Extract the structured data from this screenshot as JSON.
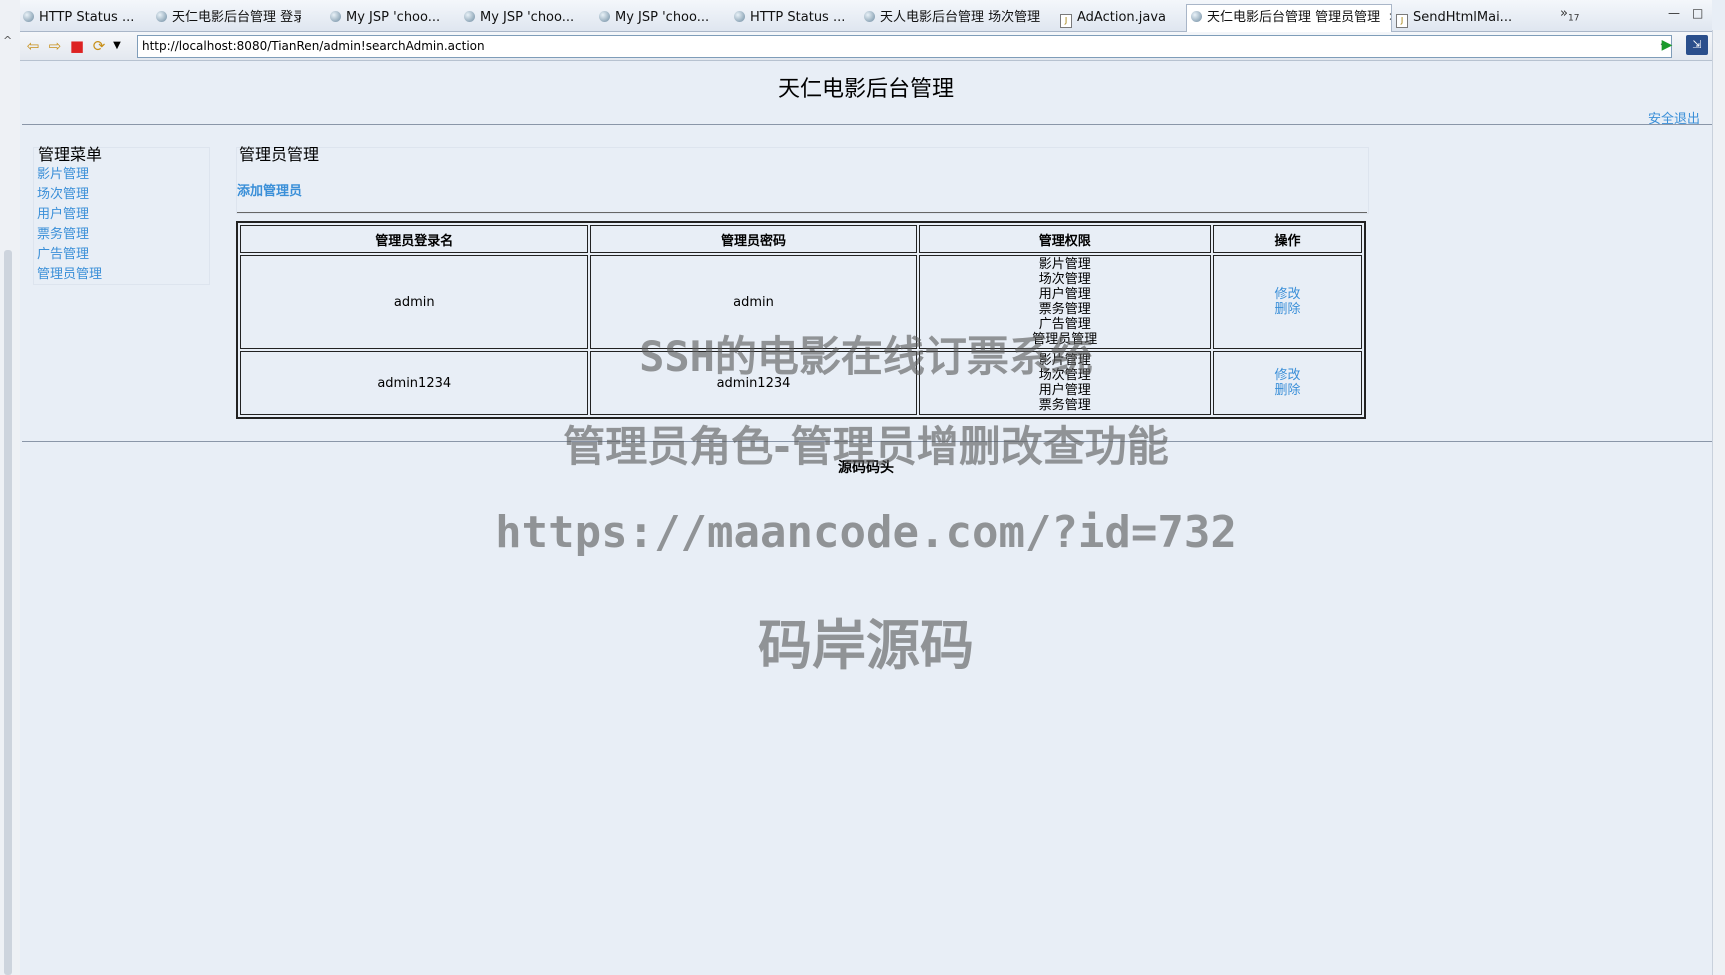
{
  "browser": {
    "tabs": [
      {
        "label": "HTTP Status ...",
        "icon": "globe-icon"
      },
      {
        "label": "天仁电影后台管理 登录",
        "icon": "globe-icon"
      },
      {
        "label": "My JSP 'choo...",
        "icon": "globe-icon"
      },
      {
        "label": "My JSP 'choo...",
        "icon": "globe-icon"
      },
      {
        "label": "My JSP 'choo...",
        "icon": "globe-icon"
      },
      {
        "label": "HTTP Status ...",
        "icon": "globe-icon"
      },
      {
        "label": "天人电影后台管理 场次管理",
        "icon": "globe-icon"
      },
      {
        "label": "AdAction.java",
        "icon": "java-file-icon"
      },
      {
        "label": "天仁电影后台管理 管理员管理",
        "icon": "globe-icon",
        "active": true
      },
      {
        "label": "SendHtmlMai...",
        "icon": "java-file-icon"
      }
    ],
    "overflow": {
      "glyph": "»",
      "count": "17"
    },
    "url": "http://localhost:8080/TianRen/admin!searchAdmin.action"
  },
  "page": {
    "title": "天仁电影后台管理",
    "logout": "安全退出",
    "menu": {
      "title": "管理菜单",
      "items": [
        "影片管理",
        "场次管理",
        "用户管理",
        "票务管理",
        "广告管理",
        "管理员管理"
      ]
    },
    "section_title": "管理员管理",
    "add_link": "添加管理员",
    "table": {
      "headers": [
        "管理员登录名",
        "管理员密码",
        "管理权限",
        "操作"
      ],
      "rows": [
        {
          "login": "admin",
          "password": "admin",
          "permissions": [
            "影片管理",
            "场次管理",
            "用户管理",
            "票务管理",
            "广告管理",
            "管理员管理"
          ],
          "edit": "修改",
          "delete": "删除"
        },
        {
          "login": "admin1234",
          "password": "admin1234",
          "permissions": [
            "影片管理",
            "场次管理",
            "用户管理",
            "票务管理"
          ],
          "edit": "修改",
          "delete": "删除"
        }
      ]
    },
    "footer": "源码码头"
  },
  "watermark": {
    "line1": "SSH的电影在线订票系统",
    "line2": "管理员角色-管理员增删改查功能",
    "line3": "https://maancode.com/?id=732",
    "line4": "码岸源码"
  },
  "colors": {
    "link": "#3a8fd8",
    "background": "#e8eef6"
  }
}
